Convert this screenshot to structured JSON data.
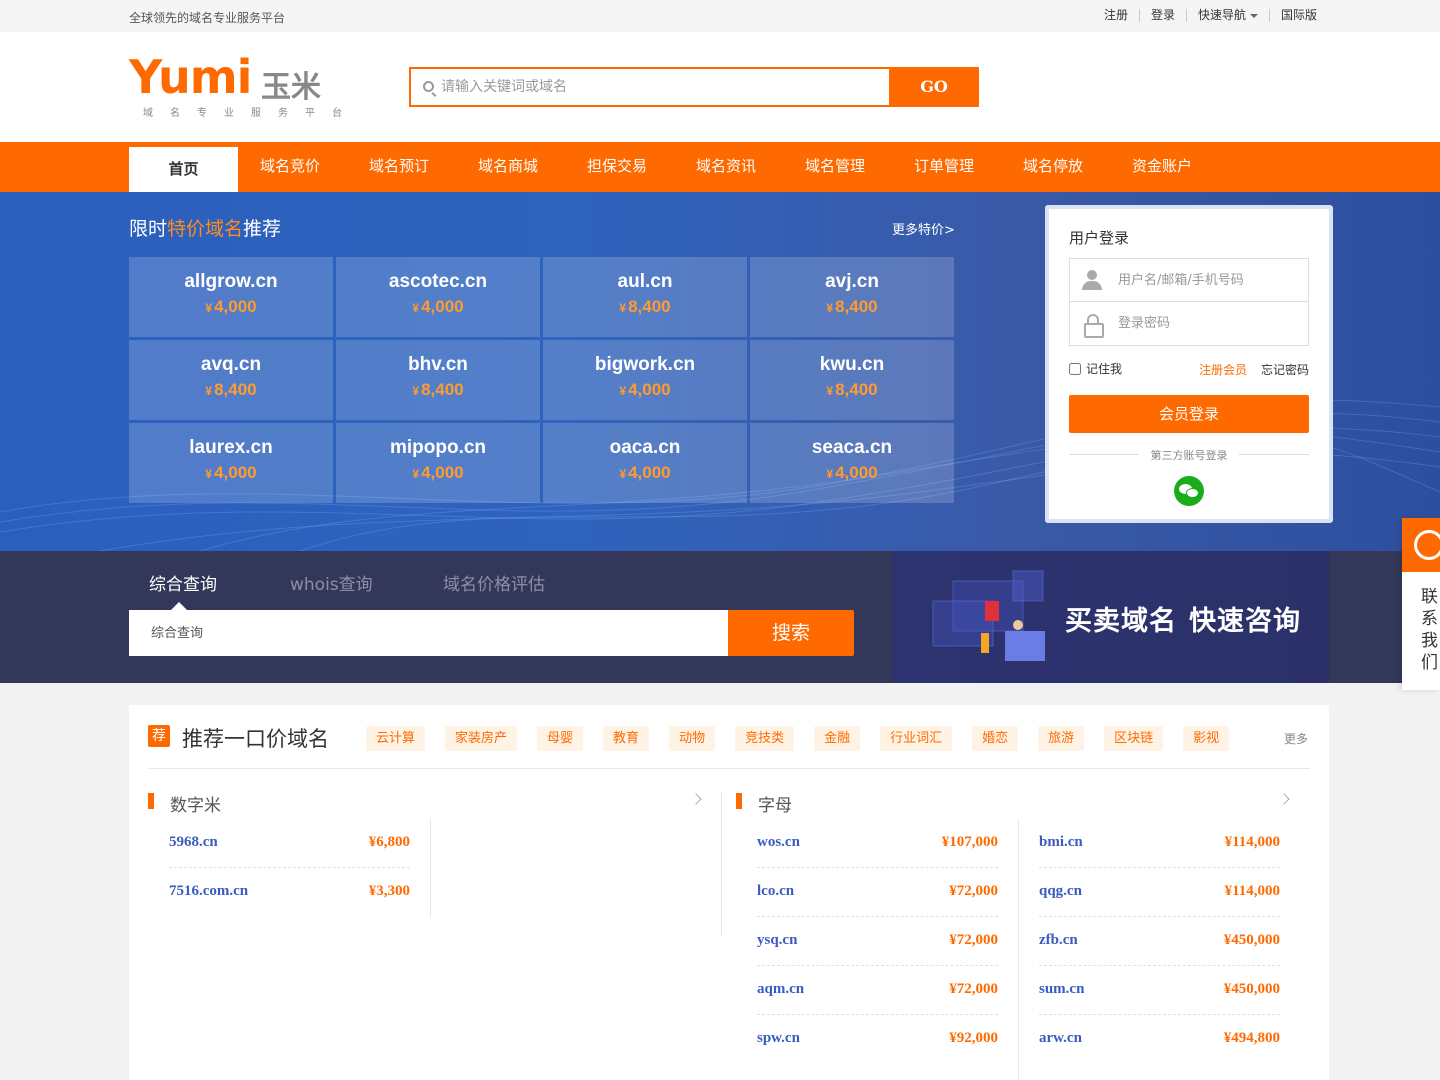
{
  "topbar": {
    "slogan": "全球领先的域名专业服务平台",
    "links": [
      "注册",
      "登录",
      "快速导航",
      "国际版"
    ]
  },
  "header": {
    "logo_word": "Yumi",
    "logo_cn": "玉米",
    "logo_tagline": "域名专业服务平台",
    "search_placeholder": "请输入关键词或域名",
    "search_button": "GO"
  },
  "nav": [
    "首页",
    "域名竞价",
    "域名预订",
    "域名商城",
    "担保交易",
    "域名资讯",
    "域名管理",
    "订单管理",
    "域名停放",
    "资金账户"
  ],
  "featured": {
    "title_prefix": "限时",
    "title_highlight": "特价域名",
    "title_suffix": "推荐",
    "more": "更多特价>",
    "currency": "¥",
    "domains": [
      {
        "name": "allgrow.cn",
        "price": "4,000"
      },
      {
        "name": "ascotec.cn",
        "price": "4,000"
      },
      {
        "name": "aul.cn",
        "price": "8,400"
      },
      {
        "name": "avj.cn",
        "price": "8,400"
      },
      {
        "name": "avq.cn",
        "price": "8,400"
      },
      {
        "name": "bhv.cn",
        "price": "8,400"
      },
      {
        "name": "bigwork.cn",
        "price": "4,000"
      },
      {
        "name": "kwu.cn",
        "price": "8,400"
      },
      {
        "name": "laurex.cn",
        "price": "4,000"
      },
      {
        "name": "mipopo.cn",
        "price": "4,000"
      },
      {
        "name": "oaca.cn",
        "price": "4,000"
      },
      {
        "name": "seaca.cn",
        "price": "4,000"
      }
    ]
  },
  "login": {
    "title": "用户登录",
    "username_placeholder": "用户名/邮箱/手机号码",
    "password_placeholder": "登录密码",
    "remember": "记住我",
    "register": "注册会员",
    "forgot": "忘记密码",
    "submit": "会员登录",
    "third_party": "第三方账号登录"
  },
  "query": {
    "tabs": [
      "综合查询",
      "whois查询",
      "域名价格评估"
    ],
    "input_placeholder": "综合查询",
    "button": "搜索",
    "ad_text": [
      "买卖域名",
      "快速咨询"
    ]
  },
  "contact": {
    "label": "联系我们"
  },
  "recommend": {
    "badge": "荐",
    "title": "推荐一口价域名",
    "tags": [
      "云计算",
      "家装房产",
      "母婴",
      "教育",
      "动物",
      "竞技类",
      "金融",
      "行业词汇",
      "婚恋",
      "旅游",
      "区块链",
      "影视"
    ],
    "more": "更多",
    "columns": [
      {
        "name": "数字米",
        "lists": [
          [
            {
              "name": "5968.cn",
              "price": "¥6,800"
            },
            {
              "name": "7516.com.cn",
              "price": "¥3,300"
            }
          ]
        ]
      },
      {
        "name": "字母",
        "lists": [
          [
            {
              "name": "wos.cn",
              "price": "¥107,000"
            },
            {
              "name": "lco.cn",
              "price": "¥72,000"
            },
            {
              "name": "ysq.cn",
              "price": "¥72,000"
            },
            {
              "name": "aqm.cn",
              "price": "¥72,000"
            },
            {
              "name": "spw.cn",
              "price": "¥92,000"
            }
          ],
          [
            {
              "name": "bmi.cn",
              "price": "¥114,000"
            },
            {
              "name": "qqg.cn",
              "price": "¥114,000"
            },
            {
              "name": "zfb.cn",
              "price": "¥450,000"
            },
            {
              "name": "sum.cn",
              "price": "¥450,000"
            },
            {
              "name": "arw.cn",
              "price": "¥494,800"
            }
          ]
        ]
      }
    ]
  },
  "colors": {
    "brand": "#ff6a00",
    "link": "#3a5cc0",
    "banner": "#2f63bd",
    "query_bg": "#33385a"
  }
}
